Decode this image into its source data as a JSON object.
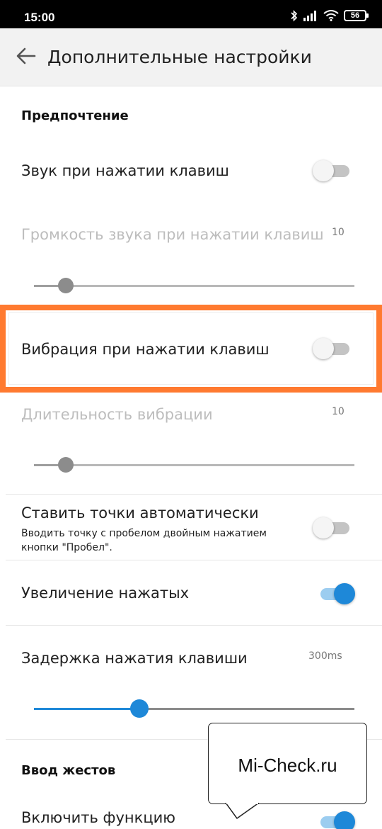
{
  "status_bar": {
    "time": "15:00",
    "battery": "56",
    "icons": [
      "bluetooth-icon",
      "signal-icon",
      "wifi-icon",
      "battery-icon"
    ]
  },
  "app_bar": {
    "title": "Дополнительные настройки",
    "back_icon": "arrow-left-icon"
  },
  "sections": {
    "preferences": {
      "header": "Предпочтение",
      "key_sound": {
        "title": "Звук при нажатии клавиш",
        "enabled": false
      },
      "sound_volume": {
        "title": "Громкость звука при нажатии клавиш",
        "value": "10",
        "level": 0.1
      },
      "key_vibration": {
        "title": "Вибрация при нажатии клавиш",
        "enabled": false
      },
      "vibration_duration": {
        "title": "Длительность вибрации",
        "value": "10",
        "level": 0.1
      },
      "auto_period": {
        "title": "Ставить точки автоматически",
        "summary": "Вводить точку с пробелом двойным нажатием кнопки \"Пробел\".",
        "enabled": false
      },
      "key_popup": {
        "title": "Увеличение нажатых",
        "enabled": true
      },
      "key_delay": {
        "title": "Задержка нажатия клавиши",
        "value": "300ms",
        "level": 0.33
      }
    },
    "gestures": {
      "header": "Ввод жестов",
      "enable": {
        "title": "Включить функцию",
        "enabled": true
      }
    }
  },
  "watermark": {
    "text": "Mi-Check.ru"
  },
  "colors": {
    "accent": "#1e88d8",
    "highlight": "#ff7a30",
    "disabled_text": "#bdbdbd"
  }
}
